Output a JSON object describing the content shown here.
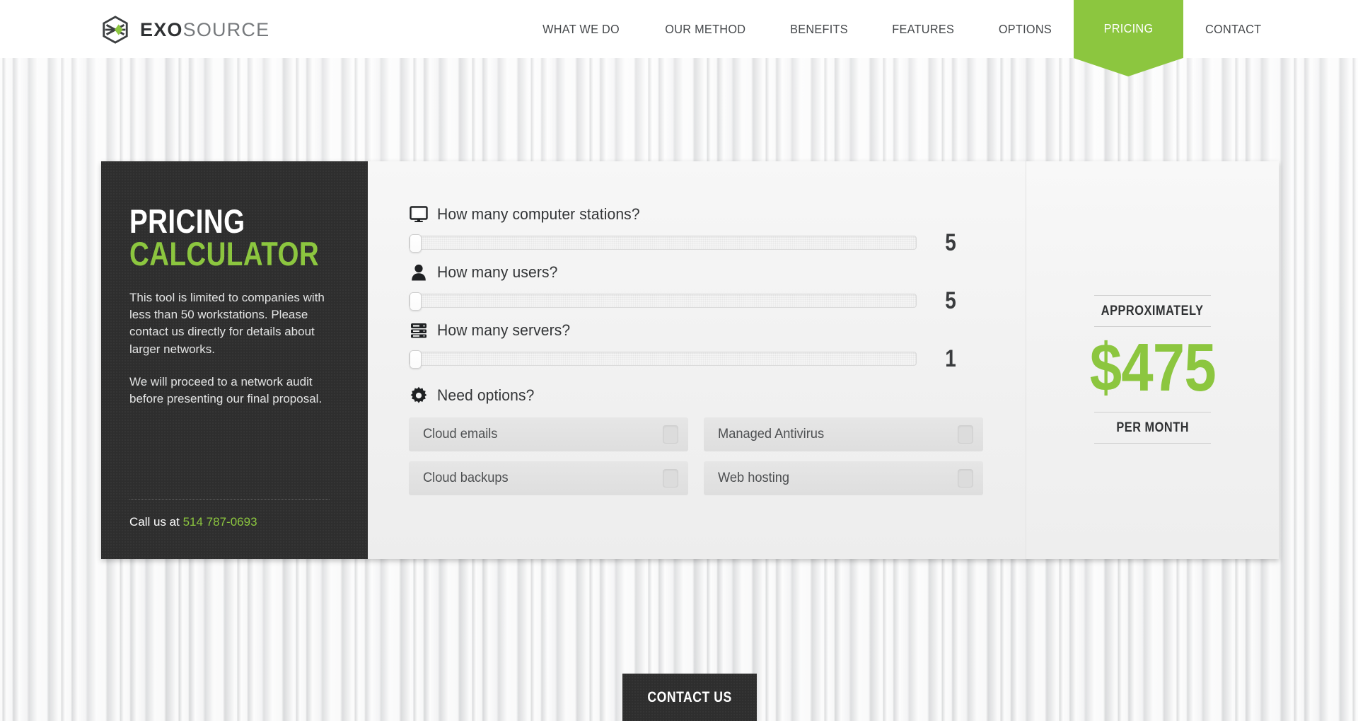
{
  "header": {
    "logo": {
      "bold": "EXO",
      "light": "SOURCE",
      "icon": "hexagon-logo-icon"
    },
    "nav": [
      {
        "label": "WHAT WE DO",
        "active": false
      },
      {
        "label": "OUR METHOD",
        "active": false
      },
      {
        "label": "BENEFITS",
        "active": false
      },
      {
        "label": "FEATURES",
        "active": false
      },
      {
        "label": "OPTIONS",
        "active": false
      },
      {
        "label": "PRICING",
        "active": true
      },
      {
        "label": "CONTACT",
        "active": false
      }
    ]
  },
  "sidebar": {
    "title_line1": "PRICING",
    "title_line2": "CALCULATOR",
    "paragraph1": "This tool is limited to companies with less than 50 workstations. Please contact us directly for details about larger networks.",
    "paragraph2": "We will proceed to a network audit before presenting our final proposal.",
    "call_prefix": "Call us at ",
    "phone": "514 787-0693"
  },
  "calculator": {
    "sliders": [
      {
        "icon": "monitor-icon",
        "label": "How many computer stations?",
        "value": "5",
        "min": 1,
        "max": 50,
        "percent": 0
      },
      {
        "icon": "user-icon",
        "label": "How many users?",
        "value": "5",
        "min": 1,
        "max": 50,
        "percent": 0
      },
      {
        "icon": "server-icon",
        "label": "How many servers?",
        "value": "1",
        "min": 0,
        "max": 20,
        "percent": 0
      }
    ],
    "options_label": "Need options?",
    "options_icon": "gear-icon",
    "options": [
      {
        "label": "Cloud emails",
        "checked": false
      },
      {
        "label": "Managed Antivirus",
        "checked": false
      },
      {
        "label": "Cloud backups",
        "checked": false
      },
      {
        "label": "Web hosting",
        "checked": false
      }
    ]
  },
  "price": {
    "approximately": "APPROXIMATELY",
    "amount": "$475",
    "per_month": "PER MONTH"
  },
  "footer": {
    "contact_button": "CONTACT US"
  },
  "colors": {
    "accent_green": "#8cc63f",
    "dark_panel": "#2e2e2e",
    "text_dark": "#333537",
    "card_light": "#f1f1f1"
  }
}
